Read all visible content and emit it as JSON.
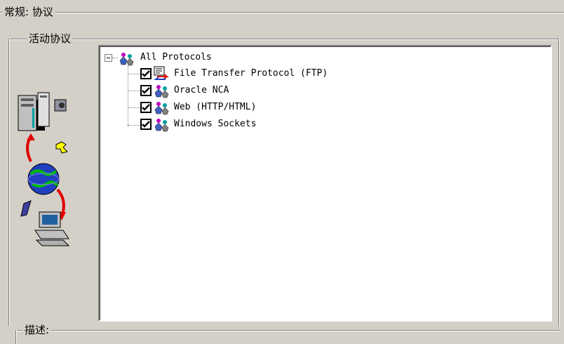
{
  "group_general": {
    "legend": "常规: 协议"
  },
  "group_active": {
    "legend": "活动协议"
  },
  "group_description": {
    "legend": "描述:"
  },
  "tree": {
    "root": {
      "label": "All Protocols",
      "expanded": true,
      "icon": "protocols-icon"
    },
    "children": [
      {
        "label": "File Transfer Protocol (FTP)",
        "checked": true,
        "icon": "ftp-icon"
      },
      {
        "label": "Oracle NCA",
        "checked": true,
        "icon": "protocol-people-icon"
      },
      {
        "label": "Web (HTTP/HTML)",
        "checked": true,
        "icon": "protocol-people-icon"
      },
      {
        "label": "Windows Sockets",
        "checked": true,
        "icon": "protocol-people-icon"
      }
    ]
  },
  "illustration": {
    "icon": "client-server-network-illustration"
  },
  "colors": {
    "window_bg": "#d4d0c8",
    "tree_bg": "#ffffff"
  }
}
